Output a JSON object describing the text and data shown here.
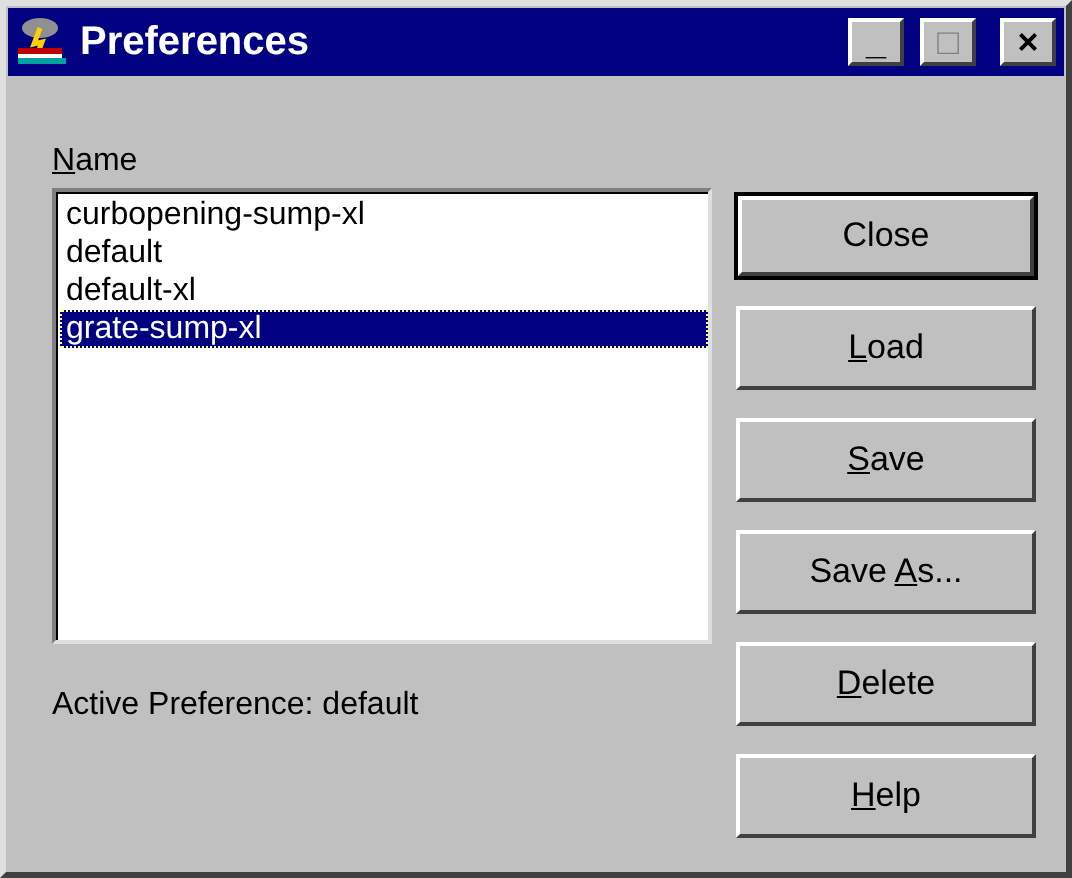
{
  "window": {
    "title": "Preferences",
    "controls": [
      "_",
      "□",
      "×"
    ]
  },
  "name_label": {
    "key": "N",
    "after": "ame"
  },
  "items": [
    {
      "label": "curbopening-sump-xl",
      "selected": false
    },
    {
      "label": "default",
      "selected": false
    },
    {
      "label": "default-xl",
      "selected": false
    },
    {
      "label": "grate-sump-xl",
      "selected": true
    }
  ],
  "active_preference": "Active Preference: default",
  "buttons": [
    {
      "before": "Close",
      "default": true
    },
    {
      "key": "L",
      "after": "oad",
      "default": false
    },
    {
      "key": "S",
      "after": "ave",
      "default": false
    },
    {
      "before": "Save ",
      "key": "A",
      "after": "s...",
      "default": false
    },
    {
      "key": "D",
      "after": "elete",
      "default": false
    },
    {
      "key": "H",
      "after": "elp",
      "default": false
    }
  ]
}
